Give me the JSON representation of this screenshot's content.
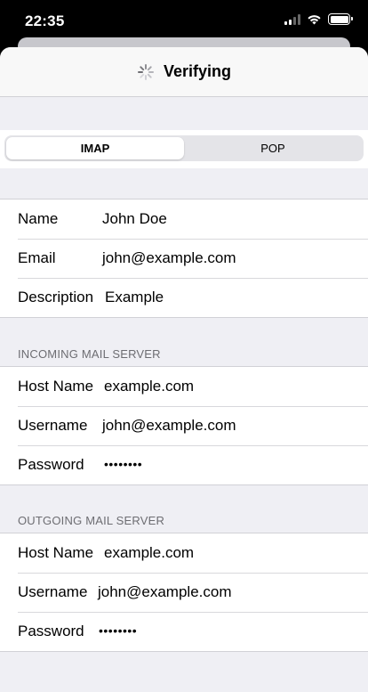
{
  "status_bar": {
    "time": "22:35"
  },
  "nav": {
    "title": "Verifying"
  },
  "segmented": {
    "options": [
      "IMAP",
      "POP"
    ],
    "selected": "IMAP"
  },
  "account": {
    "rows": [
      {
        "label": "Name",
        "value": "John Doe"
      },
      {
        "label": "Email",
        "value": "john@example.com"
      },
      {
        "label": "Description",
        "value": "Example"
      }
    ]
  },
  "incoming": {
    "header": "INCOMING MAIL SERVER",
    "host_label": "Host Name",
    "host_value": "example.com",
    "user_label": "Username",
    "user_value": "john@example.com",
    "pass_label": "Password",
    "pass_value": "••••••••"
  },
  "outgoing": {
    "header": "OUTGOING MAIL SERVER",
    "host_label": "Host Name",
    "host_value": "example.com",
    "user_label": "Username",
    "user_value": "john@example.com",
    "pass_label": "Password",
    "pass_value": "••••••••"
  },
  "colors": {
    "background": "#efeff4",
    "header_text": "#6d6d72",
    "separator": "#d1d1d6"
  },
  "icons": [
    "cellular-signal-icon",
    "wifi-icon",
    "battery-icon",
    "activity-spinner-icon"
  ]
}
